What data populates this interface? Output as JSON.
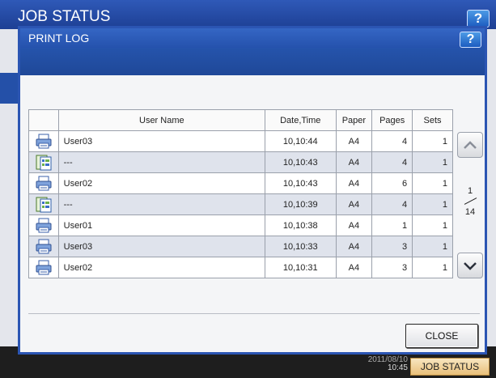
{
  "window": {
    "title": "JOB STATUS",
    "help_label": "?"
  },
  "dialog": {
    "title": "PRINT LOG",
    "help_label": "?"
  },
  "table": {
    "headers": {
      "user": "User Name",
      "date": "Date,Time",
      "paper": "Paper",
      "pages": "Pages",
      "sets": "Sets"
    },
    "rows": [
      {
        "icon": "printer-icon",
        "user": "User03",
        "date": "10,10:44",
        "paper": "A4",
        "pages": "4",
        "sets": "1"
      },
      {
        "icon": "list-print-icon",
        "user": "---",
        "date": "10,10:43",
        "paper": "A4",
        "pages": "4",
        "sets": "1"
      },
      {
        "icon": "printer-icon",
        "user": "User02",
        "date": "10,10:43",
        "paper": "A4",
        "pages": "6",
        "sets": "1"
      },
      {
        "icon": "list-print-icon",
        "user": "---",
        "date": "10,10:39",
        "paper": "A4",
        "pages": "4",
        "sets": "1"
      },
      {
        "icon": "printer-icon",
        "user": "User01",
        "date": "10,10:38",
        "paper": "A4",
        "pages": "1",
        "sets": "1"
      },
      {
        "icon": "printer-icon",
        "user": "User03",
        "date": "10,10:33",
        "paper": "A4",
        "pages": "3",
        "sets": "1"
      },
      {
        "icon": "printer-icon",
        "user": "User02",
        "date": "10,10:31",
        "paper": "A4",
        "pages": "3",
        "sets": "1"
      }
    ]
  },
  "pagination": {
    "current": "1",
    "total": "14"
  },
  "buttons": {
    "close": "CLOSE"
  },
  "status_bar": {
    "date": "2011/08/10",
    "time": "10:45",
    "job_status": "JOB STATUS"
  },
  "colors": {
    "title_blue": "#2552ad",
    "alt_row": "#dfe3ec",
    "accent_button": "#e9c07a"
  }
}
